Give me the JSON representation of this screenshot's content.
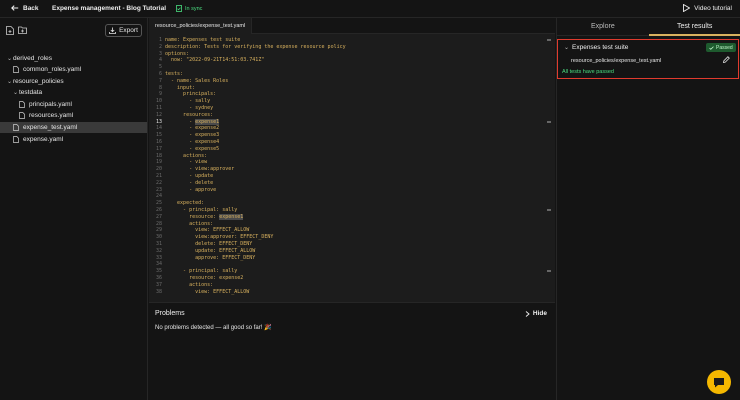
{
  "topbar": {
    "back_label": "Back",
    "title": "Expense management - Blog Tutorial",
    "sync_status": "In sync",
    "video_label": "Video tutorial"
  },
  "sidebar": {
    "export_label": "Export",
    "tree": [
      {
        "label": "derived_roles",
        "type": "folder",
        "expanded": true,
        "depth": 0
      },
      {
        "label": "common_roles.yaml",
        "type": "file",
        "depth": 1
      },
      {
        "label": "resource_policies",
        "type": "folder",
        "expanded": true,
        "depth": 0
      },
      {
        "label": "testdata",
        "type": "folder",
        "expanded": true,
        "depth": 1
      },
      {
        "label": "principals.yaml",
        "type": "file",
        "depth": 2
      },
      {
        "label": "resources.yaml",
        "type": "file",
        "depth": 2
      },
      {
        "label": "expense_test.yaml",
        "type": "file",
        "depth": 1,
        "selected": true
      },
      {
        "label": "expense.yaml",
        "type": "file",
        "depth": 1
      }
    ]
  },
  "editor": {
    "tab_label": "resource_policies/expense_test.yaml",
    "active_line": 13,
    "lines": [
      "name: Expenses test suite",
      "description: Tests for verifying the expense resource policy",
      "options:",
      "  now: \"2022-09-21T14:51:03.741Z\"",
      "",
      "tests:",
      "  - name: Sales Roles",
      "    input:",
      "      principals:",
      "        - sally",
      "        - sydney",
      "      resources:",
      "        - expense1",
      "        - expense2",
      "        - expense3",
      "        - expense4",
      "        - expense5",
      "      actions:",
      "        - view",
      "        - view:approver",
      "        - update",
      "        - delete",
      "        - approve",
      "",
      "    expected:",
      "      - principal: sally",
      "        resource: expense1",
      "        actions:",
      "          view: EFFECT_ALLOW",
      "          view:approver: EFFECT_DENY",
      "          delete: EFFECT_DENY",
      "          update: EFFECT_ALLOW",
      "          approve: EFFECT_DENY",
      "",
      "      - principal: sally",
      "        resource: expense2",
      "        actions:",
      "          view: EFFECT_ALLOW"
    ]
  },
  "problems": {
    "title": "Problems",
    "hide_label": "Hide",
    "message": "No problems detected — all good so far! 🎉"
  },
  "right_panel": {
    "tabs": [
      "Explore",
      "Test results"
    ],
    "active_tab": "Test results",
    "suite": {
      "name": "Expenses test suite",
      "status": "Passed",
      "file": "resource_policies/expense_test.yaml",
      "summary": "All tests have passed"
    }
  },
  "colors": {
    "accent": "#d8b15e",
    "success": "#4ade80",
    "highlight_border": "#e03b2e",
    "chat_button": "#f5b800"
  }
}
